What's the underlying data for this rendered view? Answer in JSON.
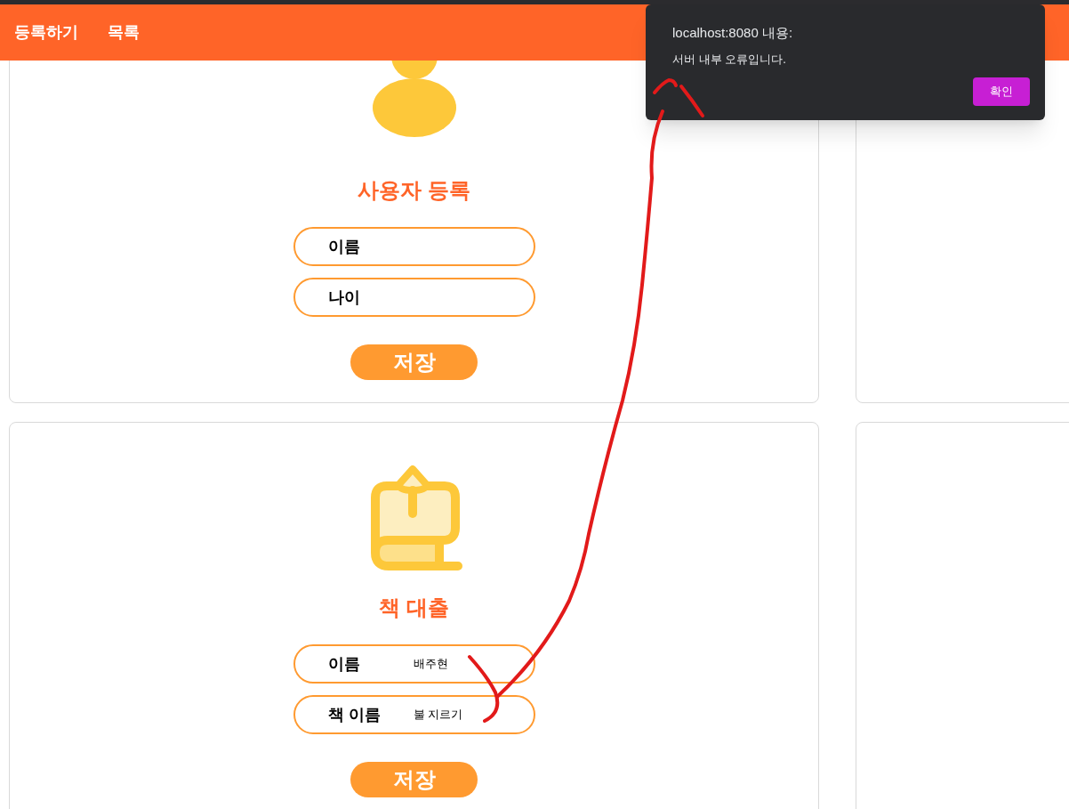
{
  "nav": {
    "items": [
      "등록하기",
      "목록"
    ]
  },
  "cards": [
    {
      "kind": "user",
      "title": "사용자 등록",
      "fields": [
        {
          "label": "이름"
        },
        {
          "label": "나이"
        }
      ],
      "button": "저장"
    },
    {
      "kind": "book",
      "title": "책 대출",
      "fields": [
        {
          "label": "이름",
          "value": "배주현"
        },
        {
          "label": "책 이름",
          "value": "불 지르기"
        }
      ],
      "button": "저장"
    }
  ],
  "dialog": {
    "title": "localhost:8080 내용:",
    "message": "서버 내부 오류입니다.",
    "button": "확인"
  }
}
